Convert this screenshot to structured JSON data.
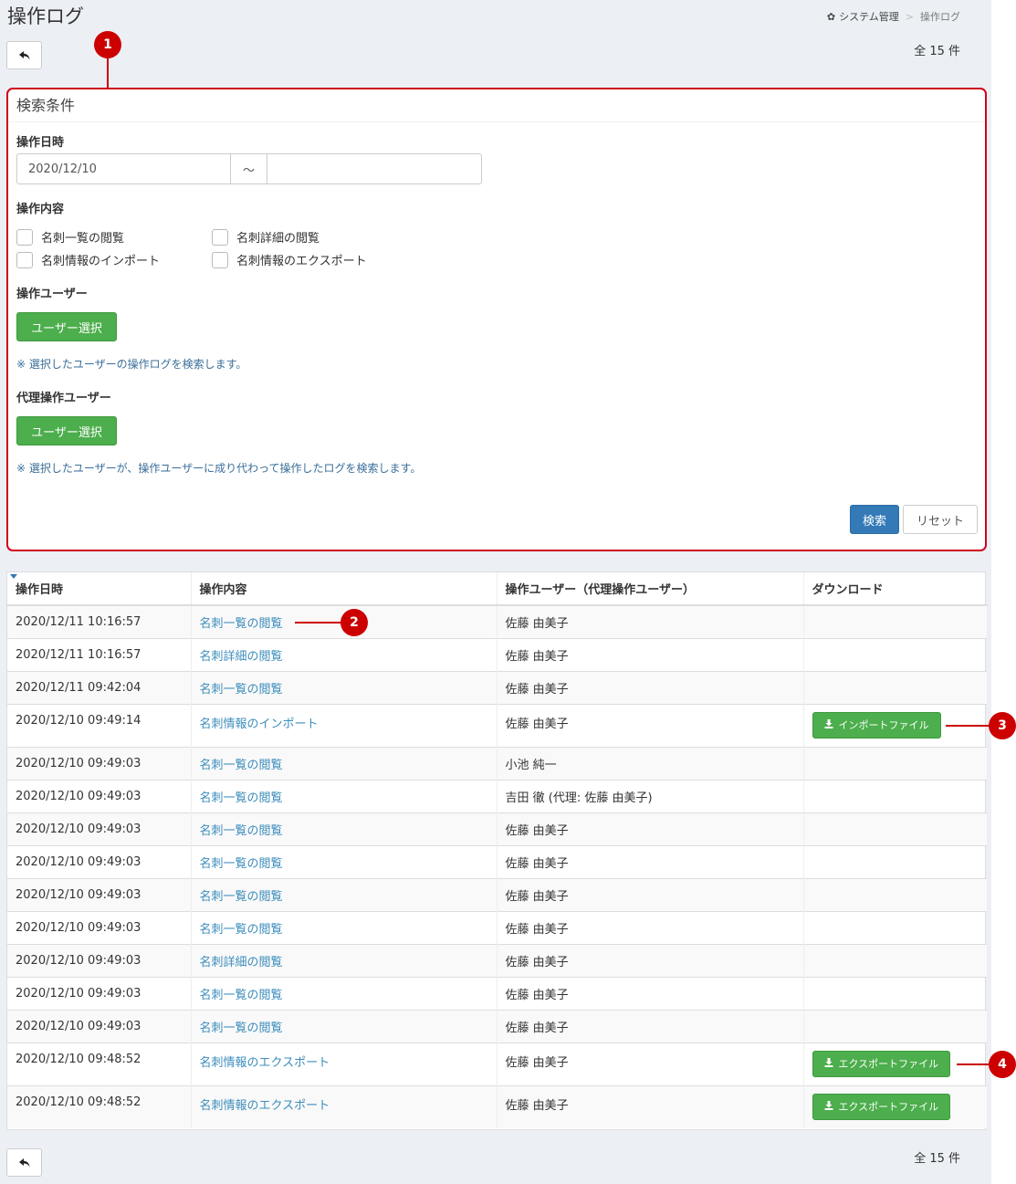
{
  "page": {
    "title": "操作ログ",
    "count": "全 15 件"
  },
  "breadcrumb": {
    "parent": "システム管理",
    "current": "操作ログ"
  },
  "search": {
    "header": "検索条件",
    "date_label": "操作日時",
    "date_from": "2020/12/10",
    "date_sep": "〜",
    "date_to": "",
    "content_label": "操作内容",
    "checkboxes": [
      "名刺一覧の閲覧",
      "名刺詳細の閲覧",
      "名刺情報のインポート",
      "名刺情報のエクスポート"
    ],
    "user_label": "操作ユーザー",
    "user_button": "ユーザー選択",
    "user_note": "※ 選択したユーザーの操作ログを検索します。",
    "proxy_label": "代理操作ユーザー",
    "proxy_button": "ユーザー選択",
    "proxy_note": "※ 選択したユーザーが、操作ユーザーに成り代わって操作したログを検索します。",
    "search_button": "検索",
    "reset_button": "リセット"
  },
  "table": {
    "headers": [
      "操作日時",
      "操作内容",
      "操作ユーザー（代理操作ユーザー）",
      "ダウンロード"
    ],
    "rows": [
      {
        "date": "2020/12/11 10:16:57",
        "action": "名刺一覧の閲覧",
        "user": "佐藤 由美子",
        "download": ""
      },
      {
        "date": "2020/12/11 10:16:57",
        "action": "名刺詳細の閲覧",
        "user": "佐藤 由美子",
        "download": ""
      },
      {
        "date": "2020/12/11 09:42:04",
        "action": "名刺一覧の閲覧",
        "user": "佐藤 由美子",
        "download": ""
      },
      {
        "date": "2020/12/10 09:49:14",
        "action": "名刺情報のインポート",
        "user": "佐藤 由美子",
        "download": "インポートファイル"
      },
      {
        "date": "2020/12/10 09:49:03",
        "action": "名刺一覧の閲覧",
        "user": "小池 純一",
        "download": ""
      },
      {
        "date": "2020/12/10 09:49:03",
        "action": "名刺一覧の閲覧",
        "user": "吉田 徹 (代理: 佐藤 由美子)",
        "download": ""
      },
      {
        "date": "2020/12/10 09:49:03",
        "action": "名刺一覧の閲覧",
        "user": "佐藤 由美子",
        "download": ""
      },
      {
        "date": "2020/12/10 09:49:03",
        "action": "名刺一覧の閲覧",
        "user": "佐藤 由美子",
        "download": ""
      },
      {
        "date": "2020/12/10 09:49:03",
        "action": "名刺一覧の閲覧",
        "user": "佐藤 由美子",
        "download": ""
      },
      {
        "date": "2020/12/10 09:49:03",
        "action": "名刺一覧の閲覧",
        "user": "佐藤 由美子",
        "download": ""
      },
      {
        "date": "2020/12/10 09:49:03",
        "action": "名刺詳細の閲覧",
        "user": "佐藤 由美子",
        "download": ""
      },
      {
        "date": "2020/12/10 09:49:03",
        "action": "名刺一覧の閲覧",
        "user": "佐藤 由美子",
        "download": ""
      },
      {
        "date": "2020/12/10 09:49:03",
        "action": "名刺一覧の閲覧",
        "user": "佐藤 由美子",
        "download": ""
      },
      {
        "date": "2020/12/10 09:48:52",
        "action": "名刺情報のエクスポート",
        "user": "佐藤 由美子",
        "download": "エクスポートファイル"
      },
      {
        "date": "2020/12/10 09:48:52",
        "action": "名刺情報のエクスポート",
        "user": "佐藤 由美子",
        "download": "エクスポートファイル"
      }
    ]
  },
  "markers": [
    "1",
    "2",
    "3",
    "4"
  ],
  "colors": {
    "accent": "#337ab7",
    "success": "#4cae4c",
    "link": "#3c8dbc",
    "marker": "#cc0000"
  }
}
